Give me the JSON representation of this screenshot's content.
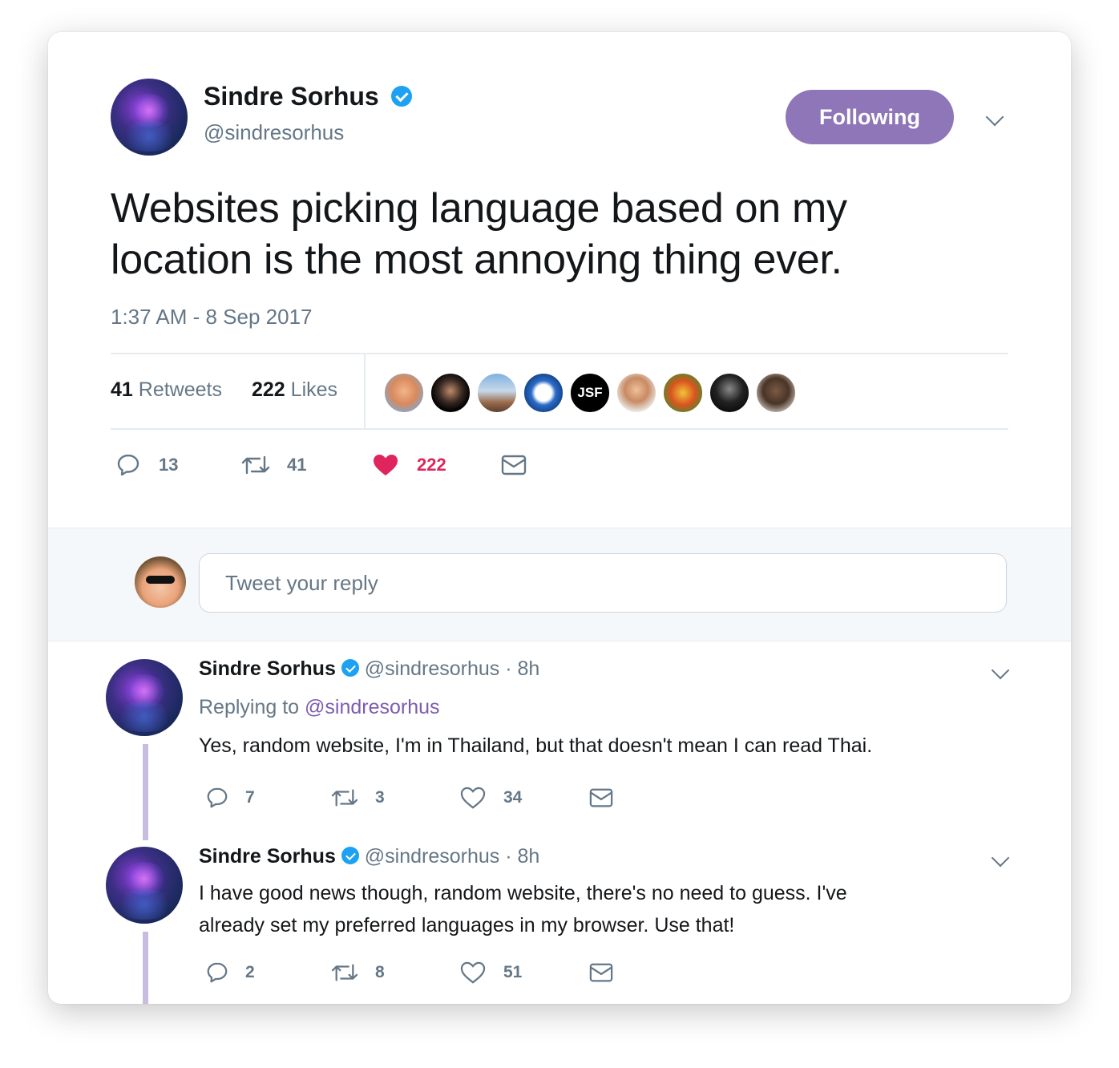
{
  "main_tweet": {
    "author_name": "Sindre Sorhus",
    "author_handle": "@sindresorhus",
    "follow_button_label": "Following",
    "text_line1": "Websites picking language based on my",
    "text_line2": "location is the most annoying thing ever.",
    "timestamp": "1:37 AM - 8 Sep 2017",
    "retweets_count": "41",
    "retweets_label": "Retweets",
    "likes_count": "222",
    "likes_label": "Likes",
    "liker_avatars": [
      "avatar-1",
      "avatar-2",
      "avatar-3",
      "avatar-4",
      "JSF",
      "avatar-6",
      "avatar-7",
      "avatar-8",
      "avatar-9"
    ],
    "actions": {
      "replies": "13",
      "retweets": "41",
      "likes": "222"
    }
  },
  "reply_composer": {
    "placeholder": "Tweet your reply"
  },
  "replies": [
    {
      "author_name": "Sindre Sorhus",
      "author_handle": "@sindresorhus",
      "time": "· 8h",
      "replying_to_label": "Replying to",
      "replying_to_handle": "@sindresorhus",
      "text_line1": "Yes, random website, I'm in Thailand, but that doesn't mean I can read Thai.",
      "actions": {
        "replies": "7",
        "retweets": "3",
        "likes": "34"
      }
    },
    {
      "author_name": "Sindre Sorhus",
      "author_handle": "@sindresorhus",
      "time": "· 8h",
      "text_line1": "I have good news though, random website, there's no need to guess. I've",
      "text_line2": "already set my preferred languages in my browser. Use that!",
      "actions": {
        "replies": "2",
        "retweets": "8",
        "likes": "51"
      }
    }
  ],
  "colors": {
    "follow_button": "#8f76b8",
    "verified": "#1da1f2",
    "like_active": "#e0245e",
    "link": "#7c5cb0",
    "muted": "#657786"
  }
}
